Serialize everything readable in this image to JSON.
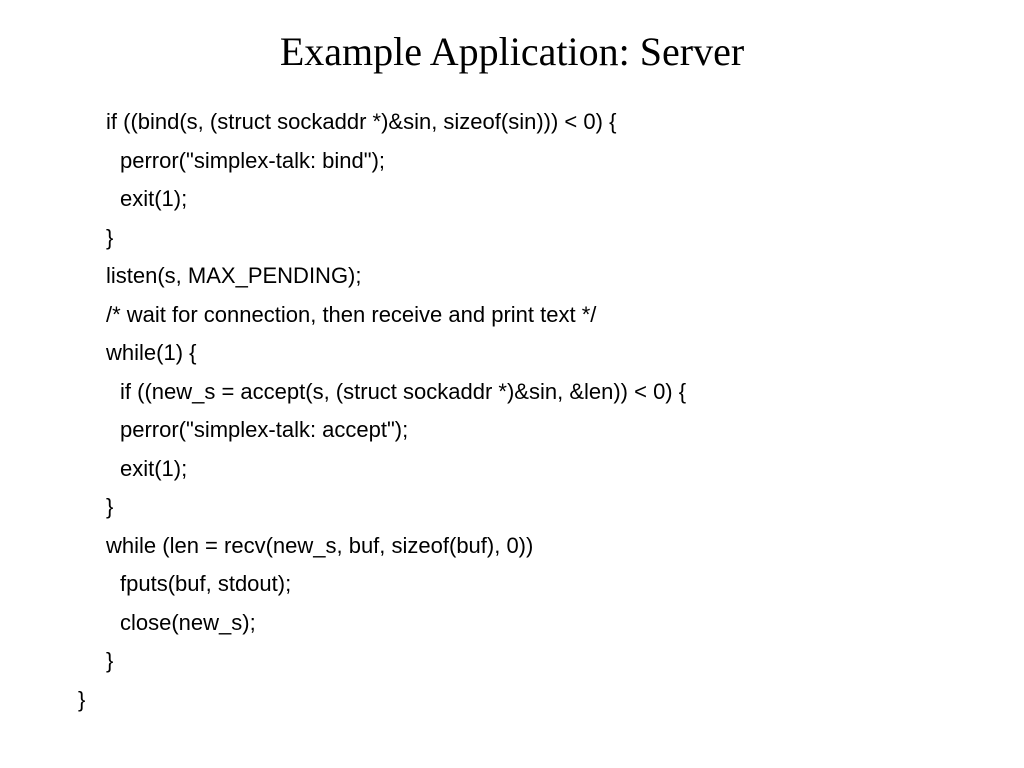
{
  "slide": {
    "title": "Example Application: Server",
    "code": {
      "l1": "if ((bind(s, (struct sockaddr *)&sin, sizeof(sin))) < 0) {",
      "l2": "perror(\"simplex-talk: bind\");",
      "l3": "exit(1);",
      "l4": "}",
      "l5": "listen(s, MAX_PENDING);",
      "l6": "/* wait for connection, then receive and print text */",
      "l7": "while(1) {",
      "l8": "if ((new_s = accept(s, (struct sockaddr *)&sin, &len)) < 0) {",
      "l9": "perror(\"simplex-talk: accept\");",
      "l10": "exit(1);",
      "l11": "}",
      "l12": "while (len = recv(new_s, buf, sizeof(buf), 0))",
      "l13": "fputs(buf, stdout);",
      "l14": "close(new_s);",
      "l15": "}",
      "l16": "}"
    }
  }
}
